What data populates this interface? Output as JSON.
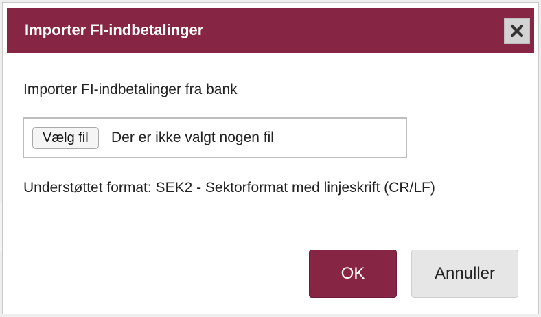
{
  "dialog": {
    "title": "Importer FI-indbetalinger",
    "close_icon": "close-icon",
    "prompt": "Importer FI-indbetalinger fra bank",
    "file_input": {
      "button_label": "Vælg fil",
      "status": "Der er ikke valgt nogen fil"
    },
    "format_note": "Understøttet format: SEK2 - Sektorformat med linjeskrift (CR/LF)",
    "buttons": {
      "ok_label": "OK",
      "cancel_label": "Annuller"
    }
  },
  "colors": {
    "brand": "#872545",
    "cancel_bg": "#e6e6e6"
  }
}
